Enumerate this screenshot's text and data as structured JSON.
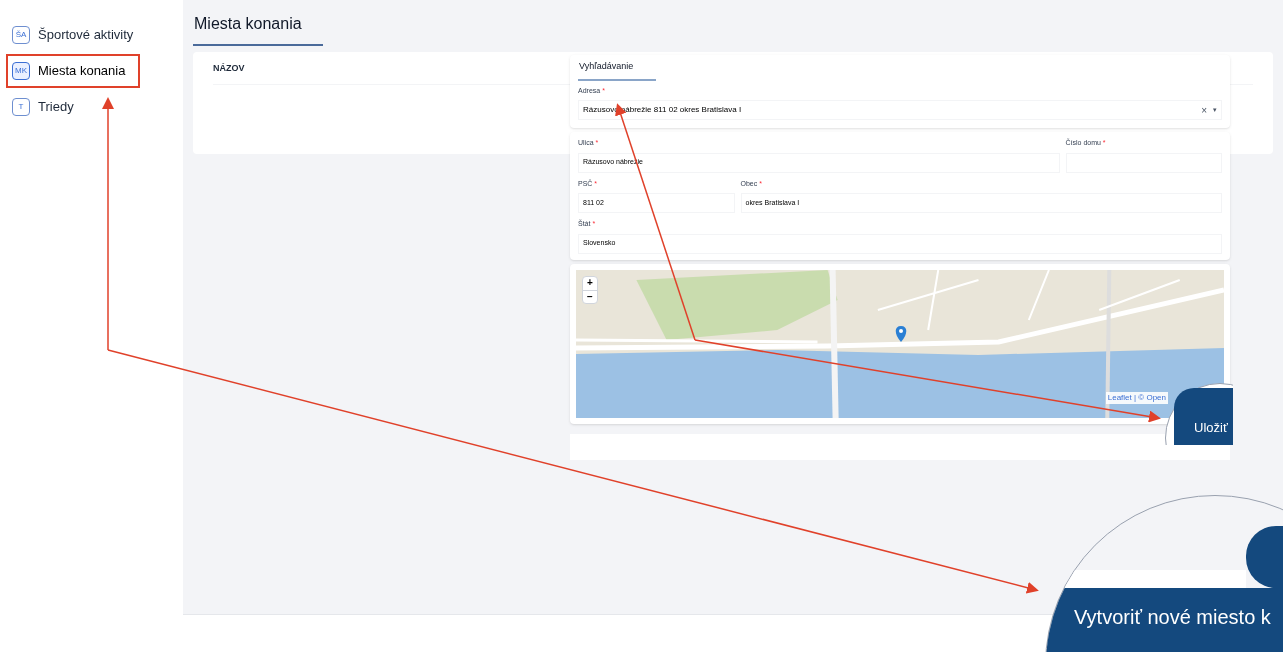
{
  "sidebar": {
    "items": [
      {
        "abbr": "ŠA",
        "label": "Športové aktivity",
        "selected": false,
        "callout": false
      },
      {
        "abbr": "MK",
        "label": "Miesta konania",
        "selected": true,
        "callout": true
      },
      {
        "abbr": "T",
        "label": "Triedy",
        "selected": false,
        "callout": false
      }
    ]
  },
  "page": {
    "title": "Miesta konania"
  },
  "table": {
    "columns": [
      "NÁZOV"
    ]
  },
  "form": {
    "tab": "Vyhľadávanie",
    "address": {
      "label": "Adresa",
      "mark": "*",
      "value": "Rázusovo nábrežie 811 02 okres Bratislava I",
      "clear": "×",
      "caret": "▾"
    },
    "rows": [
      [
        {
          "label": "Ulica",
          "mark": "*",
          "value": "Rázusovo nábrežie"
        },
        {
          "label": "Číslo domu",
          "mark": "*"
        }
      ],
      [
        {
          "label": "PSČ",
          "mark": "*",
          "value": "811 02"
        },
        {
          "label": "Obec",
          "mark": "*",
          "value": "okres Bratislava I"
        }
      ],
      [
        {
          "label": "Štát",
          "mark": "*",
          "value": "Slovensko"
        }
      ]
    ],
    "map": {
      "zoom_in": "+",
      "zoom_out": "−",
      "attribution": "Leaflet | © Open"
    }
  },
  "magnifiers": [
    {
      "text": "Uložiť"
    },
    {
      "text": "Vytvoriť nové miesto k"
    }
  ]
}
